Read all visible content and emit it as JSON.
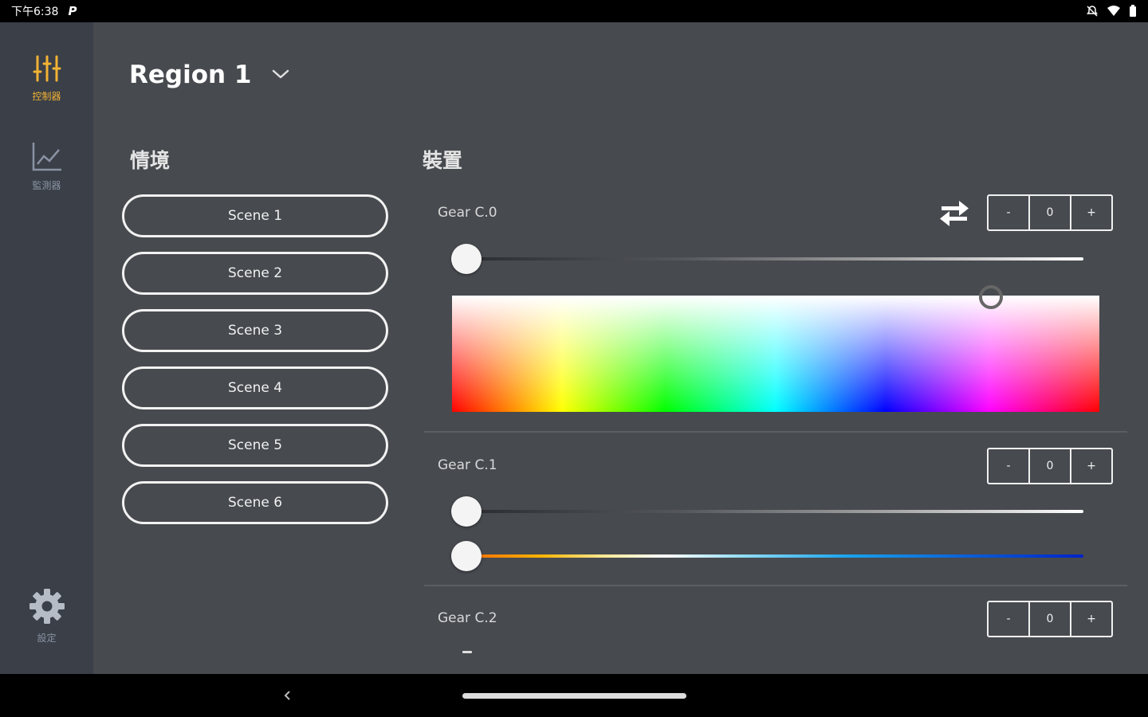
{
  "status_bar": {
    "time": "下午6:38",
    "app_indicator": "P",
    "icons": [
      "notifications-off-icon",
      "wifi-icon",
      "battery-icon"
    ]
  },
  "sidebar": {
    "items": [
      {
        "label": "控制器",
        "icon": "sliders-icon",
        "active": true
      },
      {
        "label": "監測器",
        "icon": "line-chart-icon",
        "active": false
      }
    ],
    "settings": {
      "label": "設定",
      "icon": "gear-icon"
    },
    "active_color": "#f2b233"
  },
  "header": {
    "region": "Region 1"
  },
  "scenes": {
    "title": "情境",
    "items": [
      "Scene 1",
      "Scene 2",
      "Scene 3",
      "Scene 4",
      "Scene 5",
      "Scene 6"
    ]
  },
  "devices": {
    "title": "裝置",
    "gears": [
      {
        "name": "Gear C.0",
        "stepper": {
          "minus": "-",
          "value": "0",
          "plus": "+"
        },
        "brightness": 0.0,
        "has_color_picker": true
      },
      {
        "name": "Gear C.1",
        "stepper": {
          "minus": "-",
          "value": "0",
          "plus": "+"
        },
        "brightness": 0.0,
        "cct": 0.0
      },
      {
        "name": "Gear C.2",
        "stepper": {
          "minus": "-",
          "value": "0",
          "plus": "+"
        }
      }
    ]
  }
}
